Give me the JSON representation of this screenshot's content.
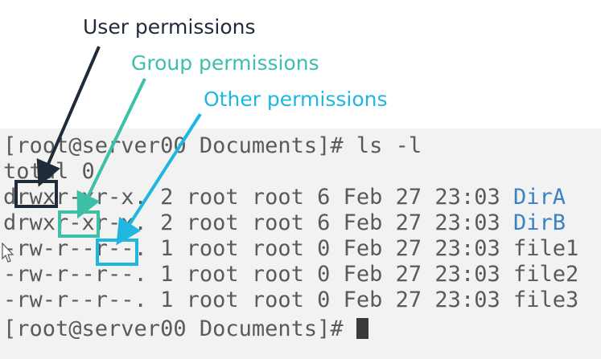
{
  "annotations": {
    "user": "User permissions",
    "group": "Group permissions",
    "other": "Other permissions"
  },
  "terminal": {
    "prompt_line": "[root@server00 Documents]# ls -l",
    "total": "total 0",
    "entries": [
      {
        "perms": "drwxr-xr-x.",
        "rest": " 2 root root 6 Feb 27 23:03 ",
        "name": "DirA",
        "is_dir": true
      },
      {
        "perms": "drwxr-xr-x.",
        "rest": " 2 root root 6 Feb 27 23:03 ",
        "name": "DirB",
        "is_dir": true
      },
      {
        "perms": "-rw-r--r--.",
        "rest": " 1 root root 0 Feb 27 23:03 ",
        "name": "file1",
        "is_dir": false
      },
      {
        "perms": "-rw-r--r--.",
        "rest": " 1 root root 0 Feb 27 23:03 ",
        "name": "file2",
        "is_dir": false
      },
      {
        "perms": "-rw-r--r--.",
        "rest": " 1 root root 0 Feb 27 23:03 ",
        "name": "file3",
        "is_dir": false
      }
    ],
    "final_prompt": "[root@server00 Documents]# "
  },
  "colors": {
    "user_annotation": "#1f2b3a",
    "group_annotation": "#3dbfa8",
    "other_annotation": "#1fb7e0",
    "directory_name": "#3b82c4",
    "terminal_text": "#5a5a5a"
  }
}
